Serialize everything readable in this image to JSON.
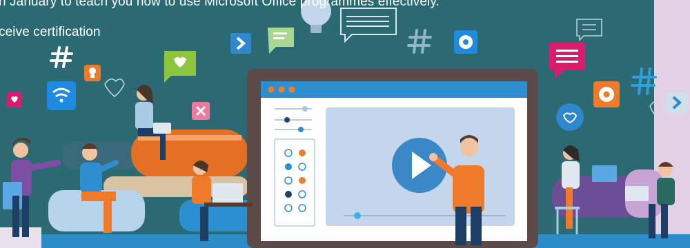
{
  "banner": {
    "line1": "n January to teach you how to use Microsoft Office programmes effectively.",
    "line2": "ceive certification"
  },
  "colors": {
    "background": "#2c6a73",
    "right_panel": "#e3d2e6",
    "screen_frame": "#5b4a47",
    "window_bar": "#2d8fd0",
    "video_panel": "#c5d6ec",
    "play_button": "#3a88c8",
    "accent_orange": "#ee7a2a",
    "accent_pink": "#d91b6b",
    "accent_green": "#8cc63f",
    "accent_blue": "#1e8be0"
  },
  "icons": [
    "hashtag-icon",
    "lightbulb-icon",
    "heart-icon",
    "wifi-icon",
    "chat-bubble-icon",
    "arrow-right-icon",
    "settings-icon",
    "close-icon",
    "play-icon"
  ]
}
